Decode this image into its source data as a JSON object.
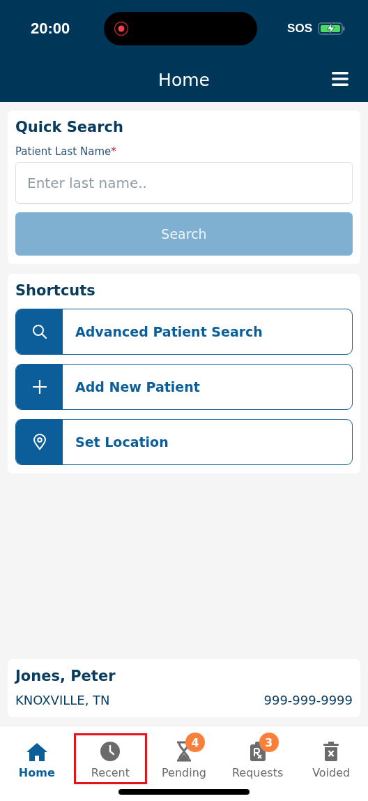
{
  "status_bar": {
    "time": "20:00",
    "recording": true,
    "sos": "SOS",
    "charging": true
  },
  "header": {
    "title": "Home"
  },
  "quick_search": {
    "title": "Quick Search",
    "field_label": "Patient Last Name",
    "required_mark": "*",
    "placeholder": "Enter last name..",
    "button": {
      "label": "Search",
      "disabled": true
    }
  },
  "shortcuts": {
    "title": "Shortcuts",
    "items": [
      {
        "kind": "search",
        "label": "Advanced Patient Search"
      },
      {
        "kind": "add",
        "label": "Add New Patient"
      },
      {
        "kind": "location",
        "label": "Set Location"
      }
    ]
  },
  "patient": {
    "name": "Jones, Peter",
    "location": "KNOXVILLE, TN",
    "phone": "999-999-9999"
  },
  "tabs": [
    {
      "kind": "home",
      "label": "Home",
      "selected": true,
      "highlighted": false
    },
    {
      "kind": "recent",
      "label": "Recent",
      "selected": false,
      "highlighted": true
    },
    {
      "kind": "pending",
      "label": "Pending",
      "selected": false,
      "highlighted": false,
      "badge": "4"
    },
    {
      "kind": "requests",
      "label": "Requests",
      "selected": false,
      "highlighted": false,
      "badge": "3"
    },
    {
      "kind": "voided",
      "label": "Voided",
      "selected": false,
      "highlighted": false
    }
  ]
}
